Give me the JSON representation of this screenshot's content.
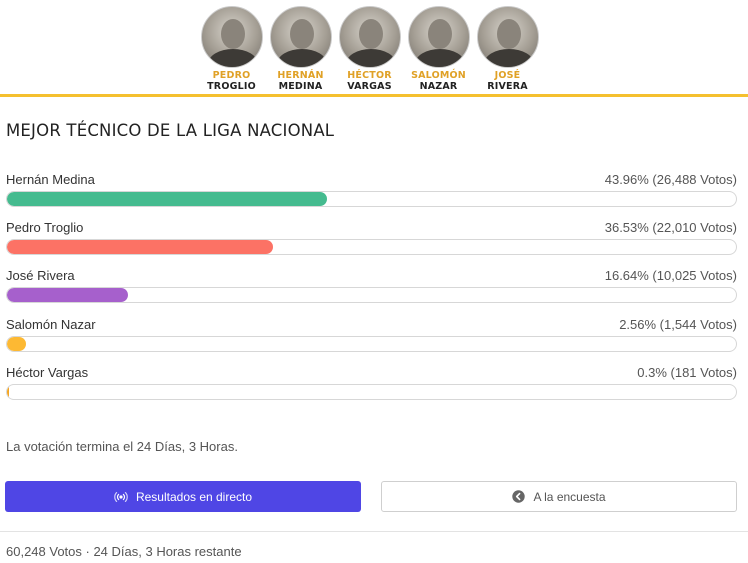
{
  "coaches": [
    {
      "first": "PEDRO",
      "last": "TROGLIO"
    },
    {
      "first": "HERNÁN",
      "last": "MEDINA"
    },
    {
      "first": "HÉCTOR",
      "last": "VARGAS"
    },
    {
      "first": "SALOMÓN",
      "last": "NAZAR"
    },
    {
      "first": "JOSÉ",
      "last": "RIVERA"
    }
  ],
  "poll": {
    "title": "MEJOR TÉCNICO DE LA LIGA NACIONAL",
    "options": [
      {
        "name": "Hernán Medina",
        "stat": "43.96% (26,488 Votos)",
        "percent": 43.96,
        "color": "#45bb8f"
      },
      {
        "name": "Pedro Troglio",
        "stat": "36.53% (22,010 Votos)",
        "percent": 36.53,
        "color": "#fc7265"
      },
      {
        "name": "José Rivera",
        "stat": "16.64% (10,025 Votos)",
        "percent": 16.64,
        "color": "#a660cc"
      },
      {
        "name": "Salomón Nazar",
        "stat": "2.56% (1,544 Votos)",
        "percent": 2.56,
        "color": "#fdb933"
      },
      {
        "name": "Héctor Vargas",
        "stat": "0.3% (181 Votos)",
        "percent": 0.3,
        "color": "#f5a623"
      }
    ],
    "ends_text": "La votación termina el 24 Días, 3 Horas.",
    "live_button": "Resultados en directo",
    "back_button": "A la encuesta",
    "footer": "60,248 Votos · 24 Días, 3 Horas restante"
  },
  "colors": {
    "accent": "#4f46e5",
    "banner_line": "#f5c02e",
    "coach_first": "#e0a126"
  },
  "icons": {
    "live": "broadcast-icon",
    "back": "arrow-left-circle-icon"
  }
}
